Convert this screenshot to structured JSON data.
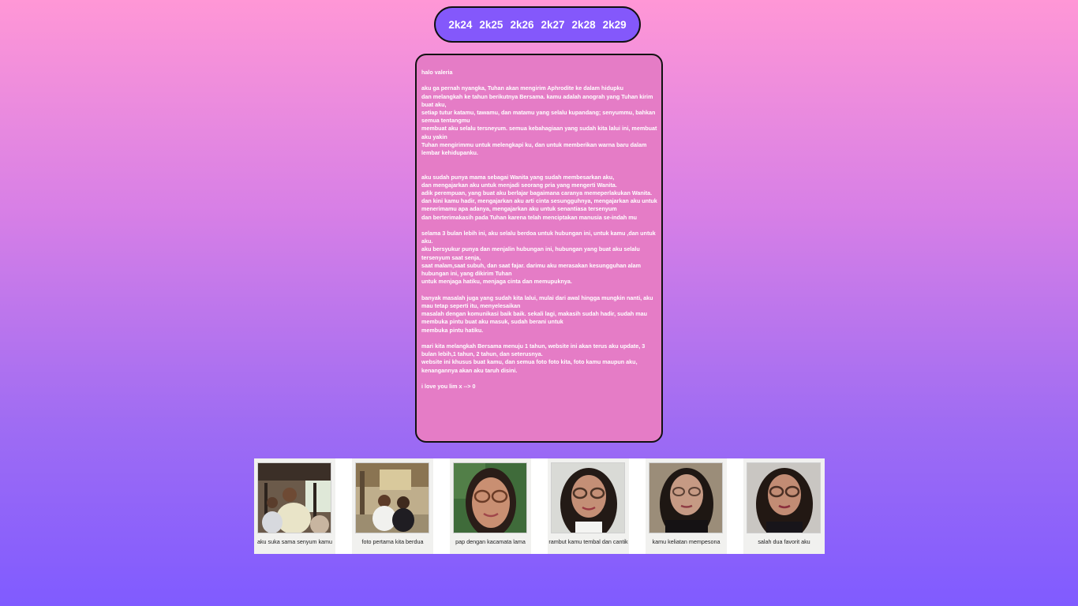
{
  "nav": {
    "years": [
      "2k24",
      "2k25",
      "2k26",
      "2k27",
      "2k28",
      "2k29"
    ]
  },
  "letter": {
    "paragraphs": [
      "halo valeria",
      "aku ga pernah nyangka, Tuhan akan mengirim Aphrodite ke dalam hidupku\ndan melangkah ke tahun berikutnya Bersama. kamu adalah anograh yang Tuhan kirim buat aku,\nsetiap tutur katamu, tawamu, dan matamu yang selalu kupandang; senyummu, bahkan semua tentangmu\nmembuat aku selalu tersneyum. semua kebahagiaan yang sudah kita lalui ini, membuat aku yakin\nTuhan mengirimmu untuk melengkapi ku, dan untuk memberikan warna baru dalam lembar kehidupanku.",
      "\naku sudah punya mama sebagai Wanita yang sudah membesarkan aku,\ndan mengajarkan aku untuk menjadi seorang pria yang mengerti Wanita.\nadik perempuan, yang buat aku berlajar bagaimana caranya memeperlakukan Wanita.\ndan kini kamu hadir, mengajarkan aku arti cinta sesungguhnya, mengajarkan aku untuk menerimamu apa adanya, mengajarkan aku untuk senantiasa tersenyum\ndan berterimakasih pada Tuhan karena telah menciptakan manusia se-indah mu",
      "selama 3 bulan lebih ini, aku selalu berdoa untuk hubungan ini, untuk kamu ,dan untuk aku.\naku bersyukur punya dan menjalin hubungan ini, hubungan yang buat aku selalu tersenyum saat senja,\nsaat malam,saat subuh, dan saat fajar. darimu aku merasakan kesungguhan alam hubungan ini, yang dikirim Tuhan\nuntuk menjaga hatiku, menjaga cinta dan memupuknya.",
      "banyak masalah juga yang sudah kita lalui, mulai dari awal hingga mungkin nanti, aku mau tetap seperti itu, menyelesaikan\nmasalah dengan komunikasi baik baik. sekali lagi, makasih sudah hadir, sudah mau membuka pintu buat aku masuk, sudah berani untuk\nmembuka pintu hatiku.",
      "mari kita melangkah Bersama menuju 1 tahun, website ini akan terus aku update, 3 bulan lebih,1 tahun, 2 tahun, dan seterusnya.\nwebsite ini khusus buat kamu, dan semua foto foto kita, foto kamu maupun aku, kenangannya akan aku taruh disini.",
      "i love you lim x --> 0"
    ]
  },
  "gallery": [
    {
      "caption": "aku suka sama senyum kamu",
      "icon": "photo-smile"
    },
    {
      "caption": "foto pertama kita berdua",
      "icon": "photo-couple"
    },
    {
      "caption": "pap dengan kacamata lama",
      "icon": "photo-glasses"
    },
    {
      "caption": "rambut kamu tembal dan cantik",
      "icon": "photo-hair"
    },
    {
      "caption": "kamu keliatan mempesona",
      "icon": "photo-charming"
    },
    {
      "caption": "salah dua favorit aku",
      "icon": "photo-favorite"
    }
  ]
}
